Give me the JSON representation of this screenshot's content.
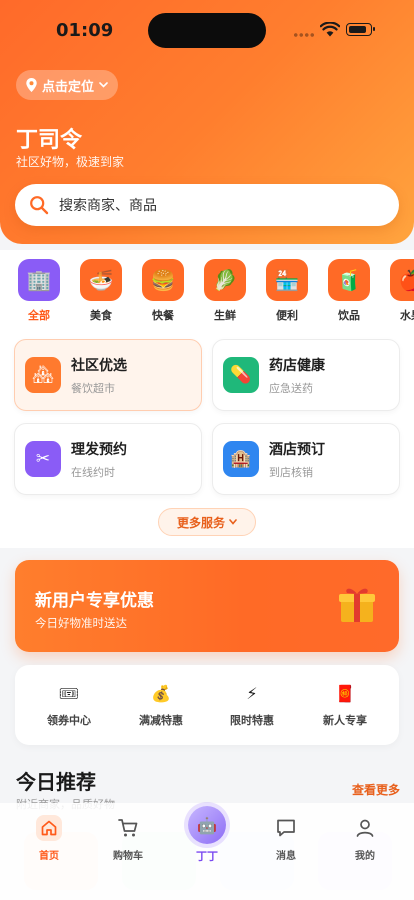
{
  "status_bar": {
    "time": "01:09"
  },
  "header": {
    "location_label": "点击定位",
    "brand": "丁司令",
    "slogan": "社区好物，极速到家",
    "search_placeholder": "搜索商家、商品"
  },
  "categories": [
    {
      "label": "全部",
      "icon": "building-icon",
      "color": "#8a5cf6",
      "active": true
    },
    {
      "label": "美食",
      "icon": "noodle-bowl-icon",
      "color": "#ff6a26"
    },
    {
      "label": "快餐",
      "icon": "burger-icon",
      "color": "#ff6a26"
    },
    {
      "label": "生鲜",
      "icon": "leafy-greens-icon",
      "color": "#ff6a26"
    },
    {
      "label": "便利",
      "icon": "store-icon",
      "color": "#ff6a26"
    },
    {
      "label": "饮品",
      "icon": "drink-icon",
      "color": "#ff6a26"
    },
    {
      "label": "水果",
      "icon": "apple-icon",
      "color": "#ff6a26"
    }
  ],
  "services": [
    {
      "title": "社区优选",
      "subtitle": "餐饮超市",
      "icon": "family-icon",
      "color": "#ff7a2e",
      "highlighted": true
    },
    {
      "title": "药店健康",
      "subtitle": "应急送药",
      "icon": "pill-icon",
      "color": "#1fb87a"
    },
    {
      "title": "理发预约",
      "subtitle": "在线约时",
      "icon": "scissors-icon",
      "color": "#8a5cf6"
    },
    {
      "title": "酒店预订",
      "subtitle": "到店核销",
      "icon": "hotel-icon",
      "color": "#2f86f0"
    }
  ],
  "more_services_label": "更多服务",
  "promo": {
    "title": "新用户专享优惠",
    "subtitle": "今日好物准时送达",
    "icon": "gift-icon"
  },
  "perks": [
    {
      "label": "领券中心",
      "icon": "ticket-icon"
    },
    {
      "label": "满减特惠",
      "icon": "money-bag-icon"
    },
    {
      "label": "限时特惠",
      "icon": "lightning-icon"
    },
    {
      "label": "新人专享",
      "icon": "red-envelope-icon"
    }
  ],
  "recommend": {
    "title": "今日推荐",
    "subtitle": "附近商家，品质好物",
    "more_label": "查看更多"
  },
  "tabbar": {
    "items": [
      {
        "label": "首页",
        "icon": "home-icon",
        "active": true
      },
      {
        "label": "购物车",
        "icon": "cart-icon"
      },
      {
        "label": "丁丁",
        "icon": "robot-icon"
      },
      {
        "label": "消息",
        "icon": "message-icon"
      },
      {
        "label": "我的",
        "icon": "profile-icon"
      }
    ]
  },
  "colors": {
    "accent": "#ff6a26",
    "brand_gradient_end": "#ffa43e",
    "purple": "#8a5cf6"
  }
}
